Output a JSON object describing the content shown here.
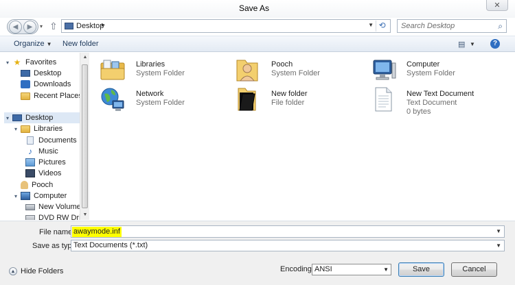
{
  "window": {
    "title": "Save As",
    "close_glyph": "✕"
  },
  "address": {
    "location": "Desktop",
    "chevron": "▸",
    "dropdown": "▼",
    "refresh_glyph": "⟲"
  },
  "search": {
    "placeholder": "Search Desktop",
    "icon": "search-icon"
  },
  "nav_buttons": {
    "back_glyph": "◀",
    "forward_glyph": "▶",
    "up_glyph": "⇧",
    "recent_glyph": "▾"
  },
  "toolbar": {
    "organize_label": "Organize",
    "organize_caret": "▼",
    "new_folder_label": "New folder",
    "view_glyph": "▤",
    "view_caret": "▼",
    "help_glyph": "?"
  },
  "navigation": {
    "items": [
      {
        "label": "Favorites",
        "icon": "star-icon"
      },
      {
        "label": "Desktop",
        "icon": "desktop-icon"
      },
      {
        "label": "Downloads",
        "icon": "downloads-icon"
      },
      {
        "label": "Recent Places",
        "icon": "recent-places-icon"
      },
      {
        "label": "Desktop",
        "icon": "desktop-icon",
        "selected": true
      },
      {
        "label": "Libraries",
        "icon": "libraries-icon"
      },
      {
        "label": "Documents",
        "icon": "documents-icon"
      },
      {
        "label": "Music",
        "icon": "music-icon"
      },
      {
        "label": "Pictures",
        "icon": "pictures-icon"
      },
      {
        "label": "Videos",
        "icon": "videos-icon"
      },
      {
        "label": "Pooch",
        "icon": "user-folder-icon"
      },
      {
        "label": "Computer",
        "icon": "computer-icon"
      },
      {
        "label": "New Volume (C",
        "icon": "drive-icon"
      },
      {
        "label": "DVD RW Drive (",
        "icon": "dvd-drive-icon"
      }
    ]
  },
  "files": [
    {
      "name": "Libraries",
      "type": "System Folder",
      "size": "",
      "icon": "libraries-icon"
    },
    {
      "name": "Pooch",
      "type": "System Folder",
      "size": "",
      "icon": "user-folder-icon"
    },
    {
      "name": "Computer",
      "type": "System Folder",
      "size": "",
      "icon": "computer-icon"
    },
    {
      "name": "Network",
      "type": "System Folder",
      "size": "",
      "icon": "network-icon"
    },
    {
      "name": "New folder",
      "type": "File folder",
      "size": "",
      "icon": "folder-icon"
    },
    {
      "name": "New Text Document",
      "type": "Text Document",
      "size": "0 bytes",
      "icon": "text-document-icon"
    }
  ],
  "form": {
    "file_name_label": "File name:",
    "file_name_value": "awaymode.inf",
    "save_as_type_label": "Save as type:",
    "save_as_type_value": "Text Documents (*.txt)",
    "encoding_label": "Encoding:",
    "encoding_value": "ANSI",
    "hide_folders_label": "Hide Folders",
    "save_label": "Save",
    "cancel_label": "Cancel",
    "caret": "▼"
  },
  "colors": {
    "highlight": "#ffff00",
    "selection": "#dde8f5",
    "accent": "#2f6ec1"
  }
}
